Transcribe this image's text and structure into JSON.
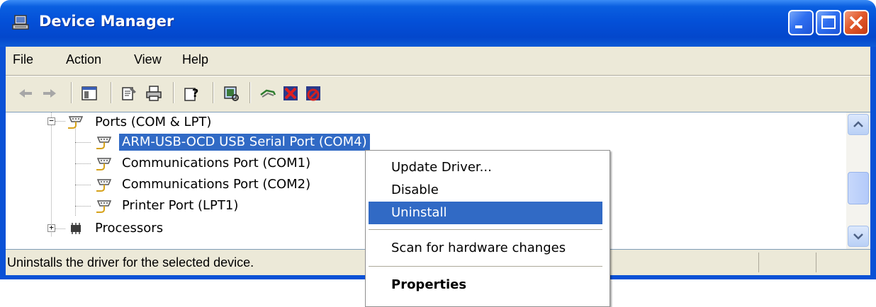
{
  "window": {
    "title": "Device Manager",
    "controls": {
      "minimize": "minimize",
      "maximize": "maximize",
      "close": "close"
    }
  },
  "menu": [
    "File",
    "Action",
    "View",
    "Help"
  ],
  "toolbar": {
    "icons": [
      "back-arrow-icon",
      "forward-arrow-icon",
      "show-hide-console-tree-icon",
      "properties-icon",
      "print-icon",
      "help-icon",
      "scan-hardware-icon",
      "update-driver-icon",
      "uninstall-icon",
      "disable-icon"
    ]
  },
  "tree": {
    "category": "Ports (COM & LPT)",
    "children": [
      {
        "label": "ARM-USB-OCD USB Serial Port (COM4)",
        "selected": true
      },
      {
        "label": "Communications Port (COM1)",
        "selected": false
      },
      {
        "label": "Communications Port (COM2)",
        "selected": false
      },
      {
        "label": "Printer Port (LPT1)",
        "selected": false
      }
    ],
    "next_category": "Processors",
    "expander_open": "−",
    "expander_closed": "+"
  },
  "status": {
    "text": "Uninstalls the driver for the selected device."
  },
  "context_menu": {
    "items": [
      "Update Driver...",
      "Disable",
      "Uninstall",
      "Scan for hardware changes",
      "Properties"
    ],
    "highlighted": "Uninstall"
  },
  "colors": {
    "titlebar": "#0450d8",
    "selection": "#316ac5",
    "face": "#ece9d8"
  }
}
